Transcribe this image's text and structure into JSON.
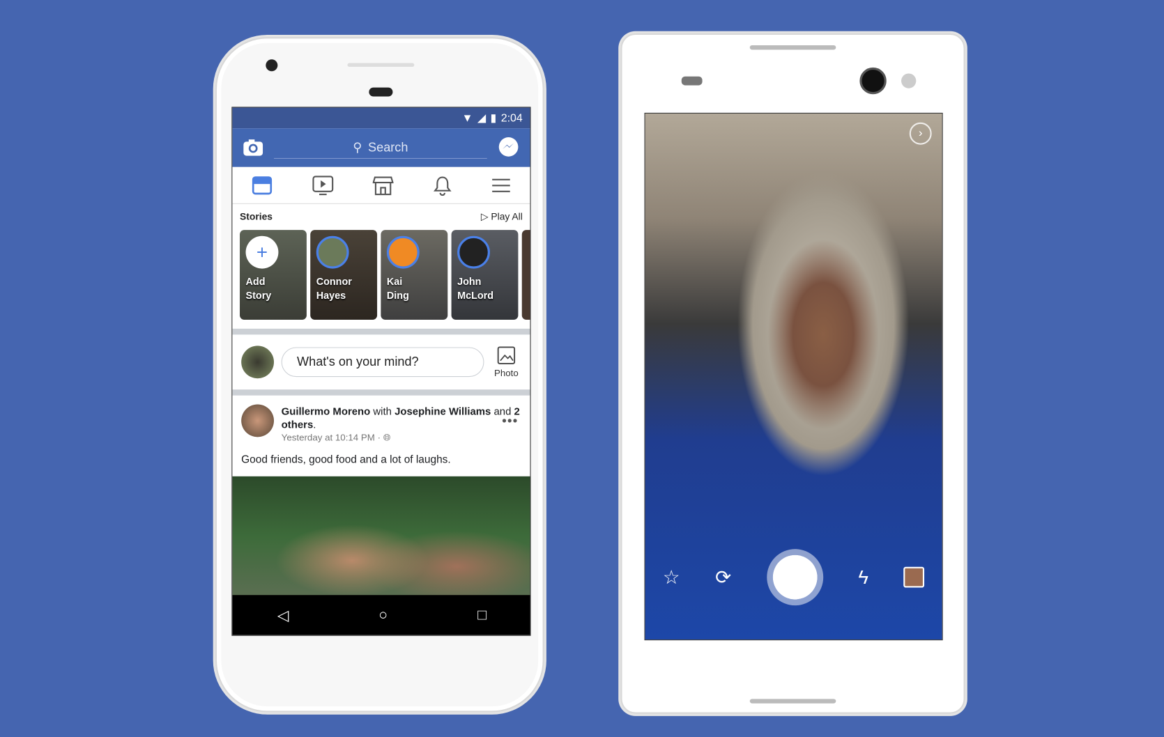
{
  "feed_phone": {
    "status": {
      "time": "2:04"
    },
    "search": {
      "placeholder": "Search"
    },
    "nav_icons": [
      "news-feed-icon",
      "watch-icon",
      "marketplace-icon",
      "notifications-icon",
      "menu-icon"
    ],
    "stories": {
      "title": "Stories",
      "play_all": "Play All",
      "items": [
        {
          "line1": "Add",
          "line2": "Story"
        },
        {
          "line1": "Connor",
          "line2": "Hayes"
        },
        {
          "line1": "Kai",
          "line2": "Ding"
        },
        {
          "line1": "John",
          "line2": "McLord"
        }
      ]
    },
    "composer": {
      "placeholder": "What's on your mind?",
      "photo_label": "Photo"
    },
    "post": {
      "author": "Guillermo Moreno",
      "with_word": " with ",
      "tagged": "Josephine Williams",
      "and_word": " and ",
      "others": "2 others",
      "period": ".",
      "time": "Yesterday at 10:14 PM · ",
      "text": "Good friends, good food and a lot of laughs.",
      "more": "•••"
    }
  },
  "camera_phone": {
    "controls": [
      "effects-icon",
      "flip-camera-icon",
      "shutter-button",
      "flash-off-icon",
      "gallery-icon"
    ]
  },
  "colors": {
    "background": "#4565b0",
    "facebook_blue": "#4267b2"
  }
}
